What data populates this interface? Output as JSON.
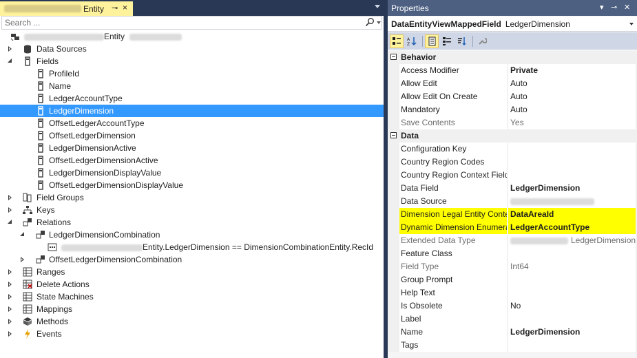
{
  "left_window": {
    "tab_title": "Entity",
    "pin_glyph": "⊸",
    "close_glyph": "×",
    "search_placeholder": "Search ...",
    "tree": {
      "root_suffix": "Entity",
      "items": [
        {
          "label": "Data Sources",
          "icon": "datasources-icon"
        },
        {
          "label": "Fields",
          "icon": "fields-icon"
        },
        {
          "label": "ProfileId",
          "icon": "field-icon"
        },
        {
          "label": "Name",
          "icon": "field-icon"
        },
        {
          "label": "LedgerAccountType",
          "icon": "field-icon"
        },
        {
          "label": "LedgerDimension",
          "icon": "field-icon",
          "selected": true
        },
        {
          "label": "OffsetLedgerAccountType",
          "icon": "field-icon"
        },
        {
          "label": "OffsetLedgerDimension",
          "icon": "field-icon"
        },
        {
          "label": "LedgerDimensionActive",
          "icon": "field-icon"
        },
        {
          "label": "OffsetLedgerDimensionActive",
          "icon": "field-icon"
        },
        {
          "label": "LedgerDimensionDisplayValue",
          "icon": "field-icon"
        },
        {
          "label": "OffsetLedgerDimensionDisplayValue",
          "icon": "field-icon"
        },
        {
          "label": "Field Groups",
          "icon": "fieldgroups-icon"
        },
        {
          "label": "Keys",
          "icon": "keys-icon"
        },
        {
          "label": "Relations",
          "icon": "relations-icon"
        },
        {
          "label": "LedgerDimensionCombination",
          "icon": "relation-icon"
        },
        {
          "label": "Entity.LedgerDimension == DimensionCombinationEntity.RecId",
          "icon": "constraint-icon"
        },
        {
          "label": "OffsetLedgerDimensionCombination",
          "icon": "relation-icon"
        },
        {
          "label": "Ranges",
          "icon": "ranges-icon"
        },
        {
          "label": "Delete Actions",
          "icon": "deleteactions-icon"
        },
        {
          "label": "State Machines",
          "icon": "statemachines-icon"
        },
        {
          "label": "Mappings",
          "icon": "mappings-icon"
        },
        {
          "label": "Methods",
          "icon": "methods-icon"
        },
        {
          "label": "Events",
          "icon": "events-icon"
        }
      ]
    }
  },
  "properties": {
    "title": "Properties",
    "object_type": "DataEntityViewMappedField",
    "object_name": "LedgerDimension",
    "categories": {
      "behavior": "Behavior",
      "data": "Data"
    },
    "rows": [
      {
        "name": "Access Modifier",
        "value": "Private",
        "bold": true
      },
      {
        "name": "Allow Edit",
        "value": "Auto"
      },
      {
        "name": "Allow Edit On Create",
        "value": "Auto"
      },
      {
        "name": "Mandatory",
        "value": "Auto"
      },
      {
        "name": "Save Contents",
        "value": "Yes",
        "readonly": true
      },
      {
        "name": "Configuration Key",
        "value": ""
      },
      {
        "name": "Country Region Codes",
        "value": ""
      },
      {
        "name": "Country Region Context Field",
        "value": ""
      },
      {
        "name": "Data Field",
        "value": "LedgerDimension",
        "bold": true
      },
      {
        "name": "Data Source",
        "value": ""
      },
      {
        "name": "Dimension Legal Entity Conte",
        "value": "DataAreaId",
        "bold": true,
        "highlight": true
      },
      {
        "name": "Dynamic Dimension Enumera",
        "value": "LedgerAccountType",
        "bold": true,
        "highlight": true
      },
      {
        "name": "Extended Data Type",
        "value": "LedgerDimension",
        "readonly": true
      },
      {
        "name": "Feature Class",
        "value": ""
      },
      {
        "name": "Field Type",
        "value": "Int64",
        "readonly": true
      },
      {
        "name": "Group Prompt",
        "value": ""
      },
      {
        "name": "Help Text",
        "value": ""
      },
      {
        "name": "Is Obsolete",
        "value": "No"
      },
      {
        "name": "Label",
        "value": ""
      },
      {
        "name": "Name",
        "value": "LedgerDimension",
        "bold": true
      },
      {
        "name": "Tags",
        "value": ""
      }
    ]
  },
  "colors": {
    "selection": "#3399ff",
    "tab_active": "#fff29d",
    "highlight": "#ffff00",
    "chrome": "#293955"
  }
}
